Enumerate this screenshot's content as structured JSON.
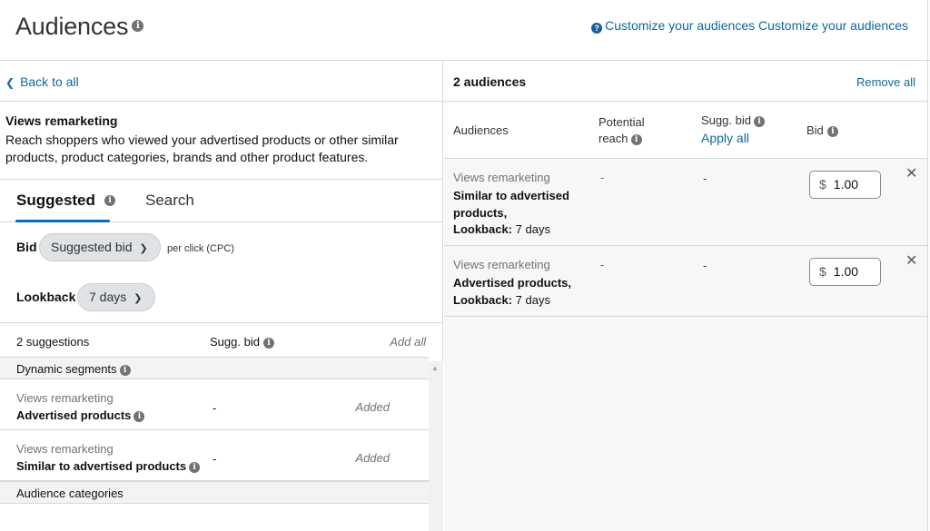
{
  "header": {
    "title": "Audiences",
    "help_link": "Customize your audiences Customize your audiences"
  },
  "left": {
    "back_label": "Back to all",
    "description_title": "Views remarketing",
    "description_text": "Reach shoppers who viewed your advertised products or other similar products, product categories, brands and other product features.",
    "tabs": [
      {
        "label": "Suggested",
        "active": true
      },
      {
        "label": "Search",
        "active": false
      }
    ],
    "bid": {
      "label": "Bid",
      "value": "Suggested bid",
      "unit": "per click (CPC)"
    },
    "lookback": {
      "label": "Lookback",
      "value": "7 days"
    },
    "list": {
      "count_label": "2 suggestions",
      "sugg_bid_label": "Sugg. bid",
      "add_all_label": "Add all",
      "groups": [
        {
          "label": "Dynamic segments"
        },
        {
          "label": "Audience categories"
        }
      ],
      "items": [
        {
          "kind": "Views remarketing",
          "name": "Advertised products",
          "sugg_bid": "-",
          "status": "Added"
        },
        {
          "kind": "Views remarketing",
          "name": "Similar to advertised products",
          "sugg_bid": "-",
          "status": "Added"
        }
      ]
    }
  },
  "right": {
    "count_label": "2 audiences",
    "remove_all_label": "Remove all",
    "columns": {
      "audiences": "Audiences",
      "potential_reach": "Potential reach",
      "sugg_bid": "Sugg. bid",
      "apply_all": "Apply all",
      "bid": "Bid"
    },
    "rows": [
      {
        "kind": "Views remarketing",
        "name": "Similar to advertised products,",
        "lookback_label": "Lookback:",
        "lookback_value": "7 days",
        "reach": "-",
        "sugg_bid": "-",
        "currency": "$",
        "bid": "1.00"
      },
      {
        "kind": "Views remarketing",
        "name": "Advertised products,",
        "lookback_label": "Lookback:",
        "lookback_value": "7 days",
        "reach": "-",
        "sugg_bid": "-",
        "currency": "$",
        "bid": "1.00"
      }
    ]
  },
  "icons": {
    "info": "info-icon",
    "help": "question-circle-icon",
    "back": "chevron-left-icon",
    "caret": "chevron-down-icon",
    "remove": "close-icon"
  },
  "colors": {
    "link": "#0a6a9c",
    "tab_underline": "#006fc4",
    "pill_bg": "#dfe3e6"
  }
}
